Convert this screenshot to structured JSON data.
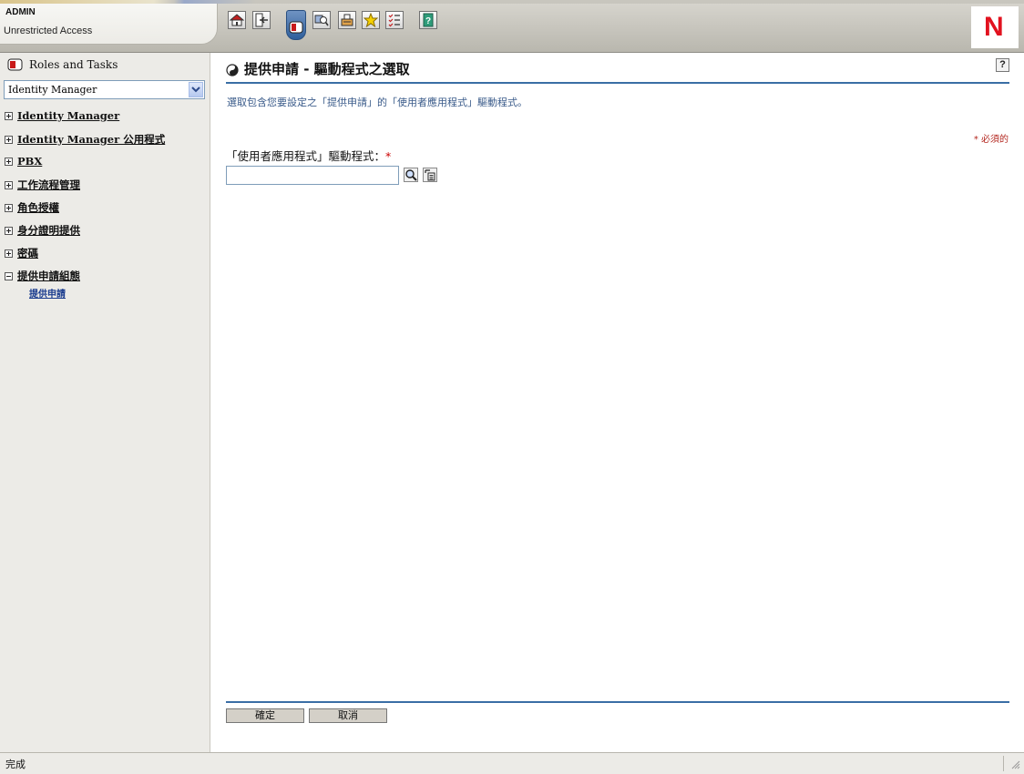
{
  "header": {
    "user": "ADMIN",
    "access": "Unrestricted Access",
    "toolbar": [
      "home-icon",
      "logout-icon",
      "roles-tab-icon",
      "search-objects-icon",
      "configure-icon",
      "favorites-icon",
      "task-list-icon",
      "help-book-icon"
    ],
    "logo_text": "N",
    "logo_color": "#e2121f"
  },
  "sidebar": {
    "title": "Roles and Tasks",
    "role_select_value": "Identity Manager",
    "items": [
      {
        "label": "Identity Manager",
        "expanded": false
      },
      {
        "label": "Identity Manager 公用程式",
        "expanded": false
      },
      {
        "label": "PBX",
        "expanded": false
      },
      {
        "label": "工作流程管理",
        "expanded": false
      },
      {
        "label": "角色授權",
        "expanded": false
      },
      {
        "label": "身分證明提供",
        "expanded": false
      },
      {
        "label": "密碼",
        "expanded": false
      },
      {
        "label": "提供申請組態",
        "expanded": true
      }
    ],
    "sub_item": "提供申請"
  },
  "main": {
    "title": "提供申請 - 驅動程式之選取",
    "help": "?",
    "description": "選取包含您要設定之「提供申請」的「使用者應用程式」驅動程式。",
    "required_note": "* 必須的",
    "field_label": "「使用者應用程式」驅動程式：",
    "field_required_mark": "*",
    "field_value": "",
    "ok_label": "確定",
    "cancel_label": "取消"
  },
  "status": {
    "text": "完成"
  }
}
